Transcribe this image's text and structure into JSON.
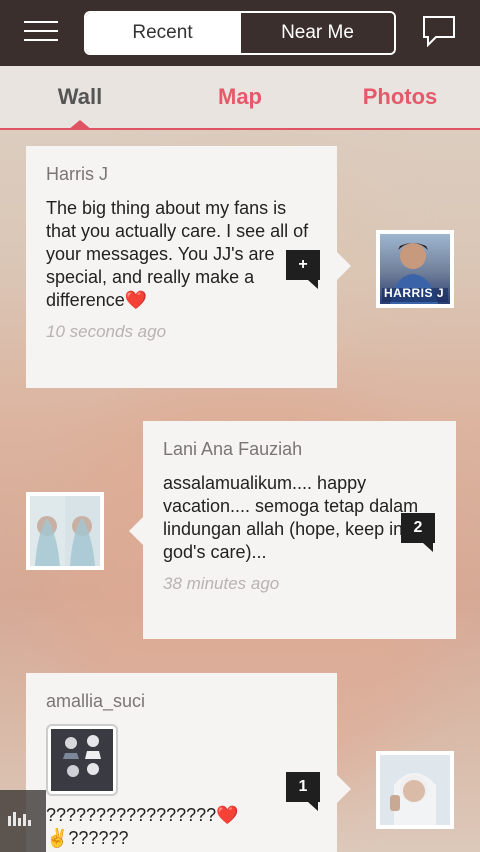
{
  "header": {
    "segments": [
      "Recent",
      "Near Me"
    ],
    "active_segment": "Recent"
  },
  "tabs": [
    {
      "label": "Wall",
      "active": true
    },
    {
      "label": "Map",
      "active": false
    },
    {
      "label": "Photos",
      "active": false
    }
  ],
  "posts": [
    {
      "author": "Harris J",
      "text": "The big thing about my fans is that you actually care. I see all of your messages. You JJ's are special, and really make a difference",
      "emoji": "❤️",
      "time": "10 seconds ago",
      "badge": "+",
      "avatar_label": "HARRIS J"
    },
    {
      "author": "Lani Ana Fauziah",
      "text": "assalamualikum.... happy vacation.... semoga tetap dalam lindungan allah (hope, keep in god's care)...",
      "time": "38 minutes ago",
      "badge": "2"
    },
    {
      "author": "amallia_suci",
      "text": "?????????????????",
      "emoji": "❤️",
      "text2": "✌️??????",
      "badge": "1"
    }
  ],
  "colors": {
    "topbar": "#3a2f2c",
    "accent": "#e05362",
    "tab_inactive": "#e45a6a"
  }
}
